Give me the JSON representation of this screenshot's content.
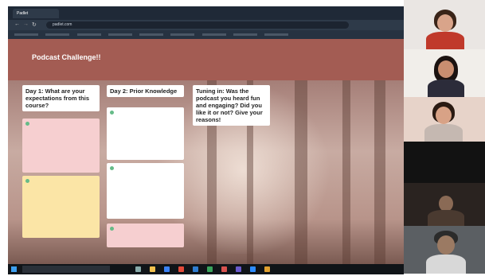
{
  "browser": {
    "tabs": [
      "Padlet",
      "",
      "",
      "",
      "",
      "",
      ""
    ],
    "url": "padlet.com"
  },
  "board": {
    "breadcrumb": "",
    "title": "Podcast Challenge!!",
    "subtitle": ""
  },
  "columns": [
    {
      "heading": "Day 1: What are your expectations from this course?"
    },
    {
      "heading": "Day 2: Prior Knowledge"
    },
    {
      "heading": "Tuning in: Was the podcast you heard fun and engaging? Did you like it or not? Give your reasons!"
    }
  ],
  "column_add": "",
  "posts": {
    "c1p1": {
      "author": "",
      "title": "",
      "body": ""
    },
    "c1p2": {
      "author": "",
      "title": "",
      "body": ""
    },
    "c2p1": {
      "author": "",
      "title": "",
      "body": ""
    },
    "c2p2": {
      "author": "",
      "title": "",
      "body": ""
    },
    "c2p3": {
      "author": "",
      "title": "",
      "body": ""
    }
  },
  "taskbar": {
    "search_placeholder": "",
    "clock": ""
  },
  "colors": {
    "header": "#a35c53",
    "post_pink": "#f6cfd0",
    "post_yellow": "#fbe5a6",
    "post_white": "#ffffff"
  },
  "icons": [
    "windows-start-icon",
    "search-icon",
    "chrome-icon",
    "file-explorer-icon",
    "mic-icon",
    "camera-icon"
  ]
}
